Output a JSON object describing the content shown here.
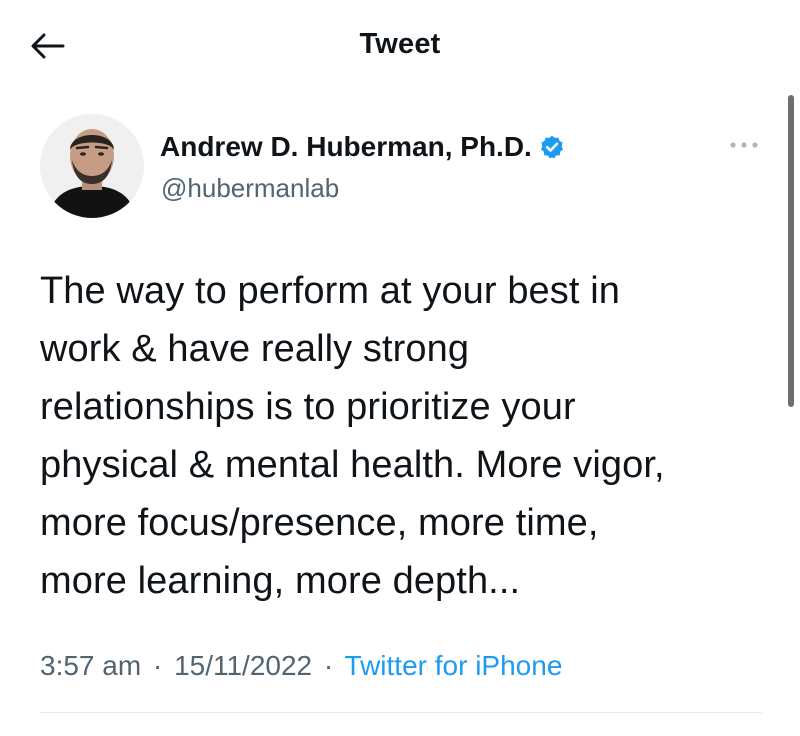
{
  "header": {
    "title": "Tweet",
    "back_icon": "arrow-left-icon"
  },
  "author": {
    "name": "Andrew D. Huberman, Ph.D.",
    "handle": "@hubermanlab",
    "verified": true,
    "verified_icon": "verified-badge-icon",
    "avatar_icon": "avatar-photo"
  },
  "tweet": {
    "lines": [
      "The way to perform at your best in",
      "work & have really strong",
      "relationships is to prioritize your",
      "physical & mental health. More vigor,",
      "more focus/presence, more time,",
      "more learning, more depth..."
    ]
  },
  "meta": {
    "time": "3:57 am",
    "separator": "·",
    "date": "15/11/2022",
    "source": "Twitter for iPhone"
  },
  "colors": {
    "text_primary": "#0f1419",
    "text_secondary": "#536471",
    "accent": "#1d9bf0"
  }
}
